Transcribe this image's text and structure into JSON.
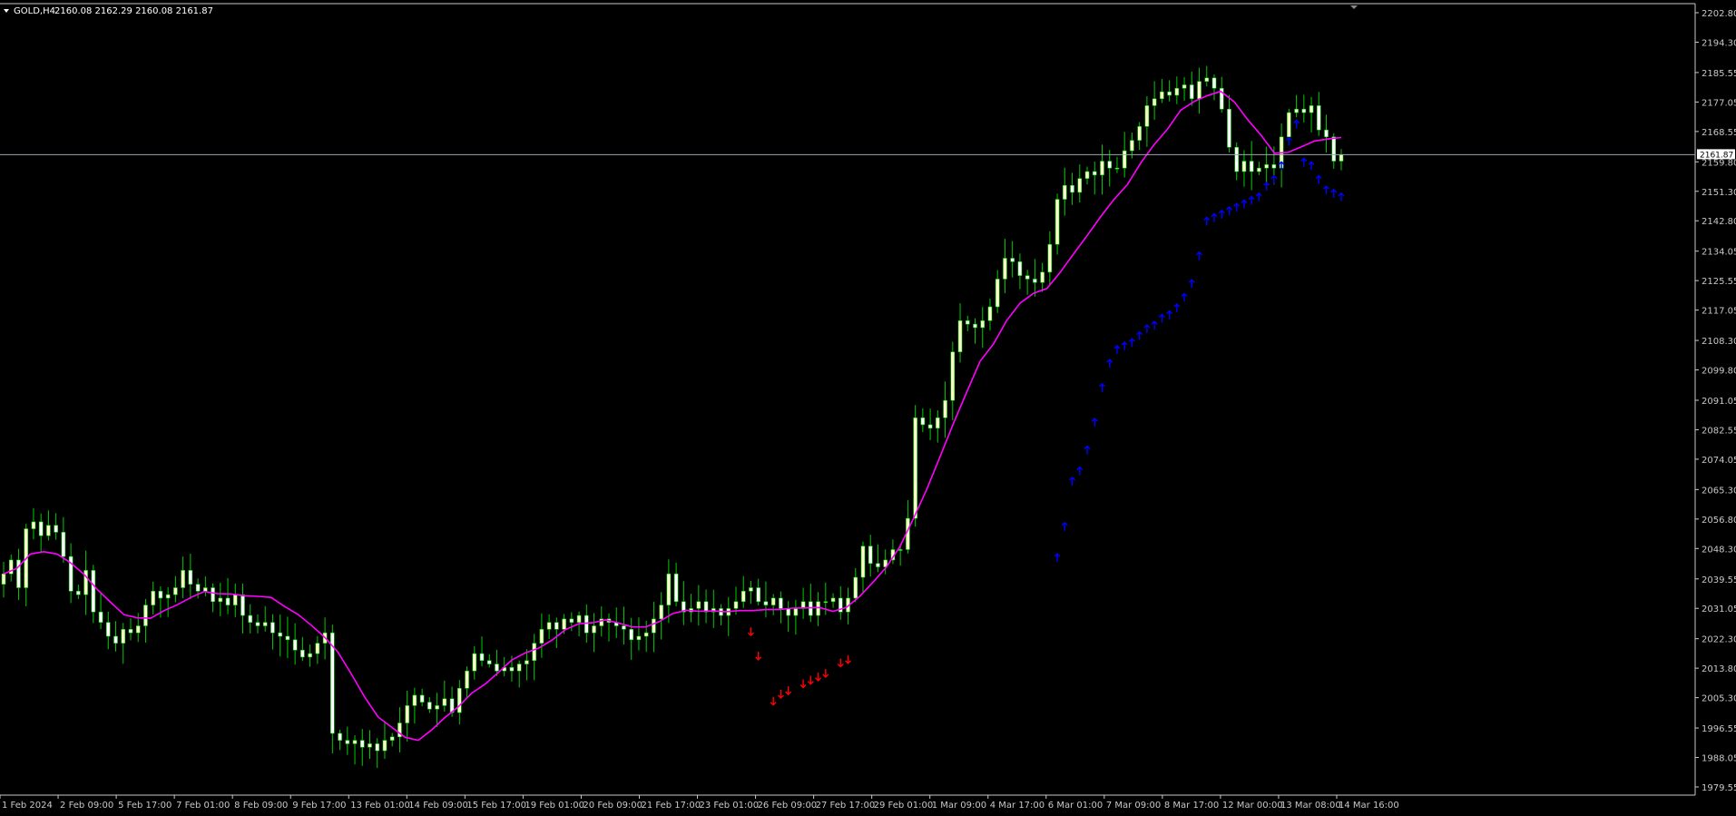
{
  "header": {
    "symbol": "GOLD,H4",
    "ohlc": "2160.08 2162.29 2160.08 2161.87"
  },
  "current_price": "2161.87",
  "colors": {
    "background": "#000000",
    "axis": "#c8c8c8",
    "bull_candle": "#ffffcc",
    "bear_candle": "#ffffff",
    "wick": "#00cc00",
    "moving_average": "#ff00ff",
    "up_arrow": "#0000ff",
    "down_arrow": "#ff0000",
    "price_line": "#9aa4b0"
  },
  "chart_data": {
    "type": "candlestick",
    "ylim": [
      1979.55,
      2202.8
    ],
    "y_ticks": [
      "2202.80",
      "2194.30",
      "2185.55",
      "2177.05",
      "2168.55",
      "2159.80",
      "2151.30",
      "2142.80",
      "2134.05",
      "2125.55",
      "2117.05",
      "2108.30",
      "2099.80",
      "2091.05",
      "2082.55",
      "2074.05",
      "2065.30",
      "2056.80",
      "2048.30",
      "2039.55",
      "2031.05",
      "2022.30",
      "2013.80",
      "2005.30",
      "1996.55",
      "1988.05",
      "1979.55"
    ],
    "x_ticks": [
      "1 Feb 2024",
      "2 Feb 09:00",
      "5 Feb 17:00",
      "7 Feb 01:00",
      "8 Feb 09:00",
      "9 Feb 17:00",
      "13 Feb 01:00",
      "14 Feb 09:00",
      "15 Feb 17:00",
      "19 Feb 01:00",
      "20 Feb 09:00",
      "21 Feb 17:00",
      "23 Feb 01:00",
      "26 Feb 09:00",
      "27 Feb 17:00",
      "29 Feb 01:00",
      "1 Mar 09:00",
      "4 Mar 17:00",
      "6 Mar 01:00",
      "7 Mar 09:00",
      "8 Mar 17:00",
      "12 Mar 00:00",
      "13 Mar 08:00",
      "14 Mar 16:00"
    ],
    "close": [
      2041,
      2045,
      2037,
      2054,
      2056,
      2052,
      2055,
      2053,
      2046,
      2036,
      2035,
      2042,
      2030,
      2027,
      2023,
      2021,
      2025,
      2024,
      2026,
      2032,
      2036,
      2034,
      2035,
      2037,
      2042,
      2038,
      2036,
      2037,
      2033,
      2034,
      2032,
      2035,
      2029,
      2027,
      2026,
      2027,
      2024,
      2023,
      2022,
      2019,
      2017,
      2018,
      2021,
      2024,
      1995,
      1993,
      1992,
      1993,
      1991,
      1992,
      1990,
      1993,
      1994,
      1998,
      2003,
      2006,
      2004,
      2002,
      2003,
      2005,
      2001,
      2008,
      2013,
      2018,
      2016,
      2015,
      2013,
      2014,
      2013,
      2015,
      2016,
      2021,
      2025,
      2027,
      2025,
      2028,
      2027,
      2029,
      2024,
      2026,
      2028,
      2027,
      2026,
      2025,
      2022,
      2023,
      2024,
      2028,
      2032,
      2041,
      2033,
      2030,
      2031,
      2033,
      2030,
      2031,
      2029,
      2031,
      2033,
      2036,
      2037,
      2033,
      2032,
      2034,
      2031,
      2029,
      2031,
      2033,
      2029,
      2033,
      2033,
      2034,
      2030,
      2034,
      2040,
      2049,
      2044,
      2043,
      2045,
      2048,
      2048,
      2057,
      2086,
      2084,
      2083,
      2086,
      2091,
      2105,
      2114,
      2113,
      2112,
      2114,
      2118,
      2126,
      2132,
      2131,
      2127,
      2126,
      2125,
      2128,
      2136,
      2149,
      2153,
      2151,
      2155,
      2157,
      2156,
      2160,
      2158,
      2158,
      2163,
      2166,
      2170,
      2176,
      2178,
      2180,
      2179,
      2181,
      2182,
      2178,
      2183,
      2184,
      2181,
      2175,
      2164,
      2157,
      2160,
      2157,
      2158,
      2159,
      2158,
      2167,
      2174,
      2175,
      2174,
      2176,
      2169,
      2167,
      2160,
      2161.87
    ],
    "ma": [
      2041,
      2042.6,
      2046.7,
      2047.4,
      2046.7,
      2044.2,
      2040.9,
      2036.5,
      2032.8,
      2029.2,
      2028.3,
      2028.2,
      2030.4,
      2032.1,
      2034.2,
      2035.9,
      2035.3,
      2035.2,
      2034.7,
      2034.5,
      2034.2,
      2031.6,
      2029.3,
      2026.2,
      2022.7,
      2018.4,
      2012.1,
      2005.4,
      1999.7,
      1996.8,
      1993.9,
      1993,
      1996,
      1999.6,
      2002.7,
      2006.6,
      2009.2,
      2012.6,
      2016.2,
      2018.2,
      2019.6,
      2021.9,
      2024.9,
      2026.6,
      2026.9,
      2027.7,
      2026.8,
      2025.7,
      2025.7,
      2027.2,
      2029.5,
      2030.5,
      2030.2,
      2030.3,
      2030.1,
      2030.4,
      2030.4,
      2030.7,
      2030.7,
      2031.1,
      2031.2,
      2031.3,
      2030.2,
      2031.3,
      2034.5,
      2038.6,
      2043,
      2048.8,
      2056.8,
      2065.3,
      2074.7,
      2084.3,
      2093.4,
      2102.3,
      2107.3,
      2114.1,
      2119.1,
      2121.9,
      2123.3,
      2128,
      2133.3,
      2138.5,
      2143.9,
      2148.9,
      2153.2,
      2159.4,
      2164.7,
      2169.2,
      2174.7,
      2177.2,
      2178.9,
      2180.1,
      2177.1,
      2172,
      2167.5,
      2162.3,
      2162.5,
      2164.1,
      2165.8,
      2166.4,
      2166.8
    ],
    "arrows_down": [
      [
        2024,
        0
      ],
      [
        2017,
        0
      ],
      [
        2004,
        0
      ],
      [
        2006,
        0
      ],
      [
        2007,
        0
      ],
      [
        2009,
        0
      ],
      [
        2010,
        0
      ],
      [
        2011,
        0
      ],
      [
        2012,
        0
      ],
      [
        2015,
        0
      ],
      [
        2016,
        0
      ]
    ],
    "arrows_up": [
      2046,
      2055,
      2068,
      2071,
      2077,
      2085,
      2095,
      2102,
      2106,
      2107,
      2108,
      2110,
      2112,
      2113,
      2115,
      2116,
      2118,
      2121,
      2125,
      2133,
      2143,
      2144,
      2145,
      2146,
      2147,
      2148,
      2149,
      2150,
      2153,
      2155,
      2159,
      2166,
      2171,
      2160,
      2159,
      2155,
      2152,
      2151,
      2150,
      2150,
      2150,
      2151,
      2151,
      2152,
      2152,
      2152,
      2153
    ]
  }
}
